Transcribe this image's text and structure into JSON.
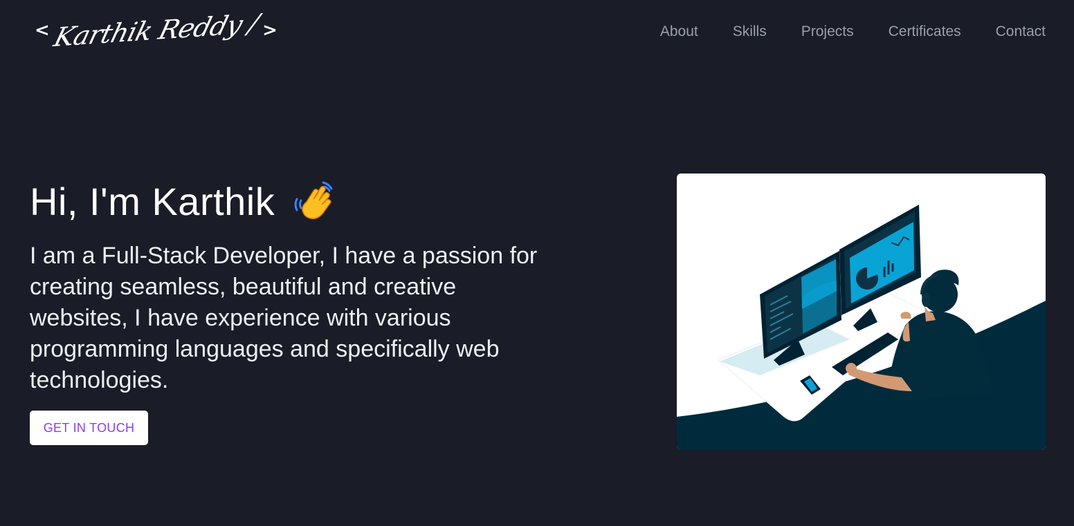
{
  "header": {
    "logo": {
      "open_bracket": "<",
      "name": "Karthik Reddy /",
      "close_bracket": ">"
    },
    "nav": [
      "About",
      "Skills",
      "Projects",
      "Certificates",
      "Contact"
    ]
  },
  "hero": {
    "greeting": "Hi, I'm Karthik",
    "wave_icon": "waving-hand-icon",
    "description": "I am a Full-Stack Developer, I have a passion for creating seamless, beautiful and creative websites, I have experience with various programming languages and specifically web technologies.",
    "cta_label": "GET IN TOUCH"
  },
  "colors": {
    "background": "#1a1c27",
    "nav_text": "#98a0ab",
    "cta_text": "#8a3fe0",
    "illustration_dark": "#002b3d",
    "illustration_accent": "#0aa3d6"
  }
}
